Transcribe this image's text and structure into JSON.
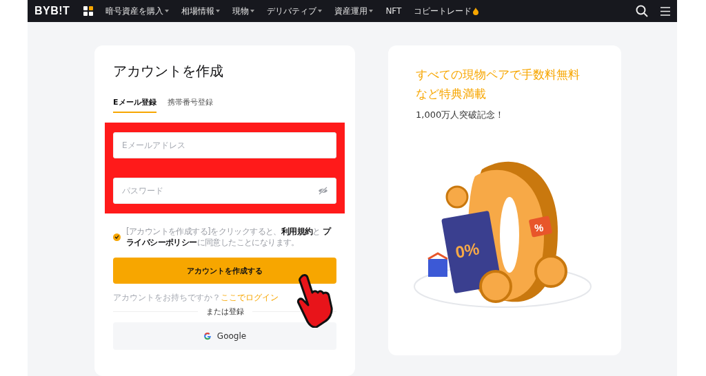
{
  "nav": {
    "logo": "BYB!T",
    "menu": [
      {
        "label": "暗号資産を購入",
        "dropdown": true
      },
      {
        "label": "相場情報",
        "dropdown": true
      },
      {
        "label": "現物",
        "dropdown": true
      },
      {
        "label": "デリバティブ",
        "dropdown": true
      },
      {
        "label": "資産運用",
        "dropdown": true
      },
      {
        "label": "NFT",
        "dropdown": false
      },
      {
        "label": "コピートレード",
        "dropdown": false,
        "hot": true
      }
    ]
  },
  "form": {
    "title": "アカウントを作成",
    "tabs": [
      {
        "label": "Eメール登録",
        "selected": true
      },
      {
        "label": "携帯番号登録",
        "selected": false
      }
    ],
    "email": {
      "placeholder": "Eメールアドレス"
    },
    "password": {
      "placeholder": "パスワード"
    },
    "consent": {
      "checked": true,
      "text": "[アカウントを作成する]をクリックすると、**利用規約**と **プライバシーポリシー**に同意したことになります。"
    },
    "submit": "アカウントを作成する",
    "login_prompt": "アカウントをお持ちですか？",
    "login_link": "ここでログイン",
    "divider": "または登録",
    "google": "Google"
  },
  "promo": {
    "headline": "すべての現物ペアで手数料無料など特典満載",
    "subline": "1,000万人突破記念！",
    "ticket_label": "0%",
    "tag_label": "%"
  }
}
